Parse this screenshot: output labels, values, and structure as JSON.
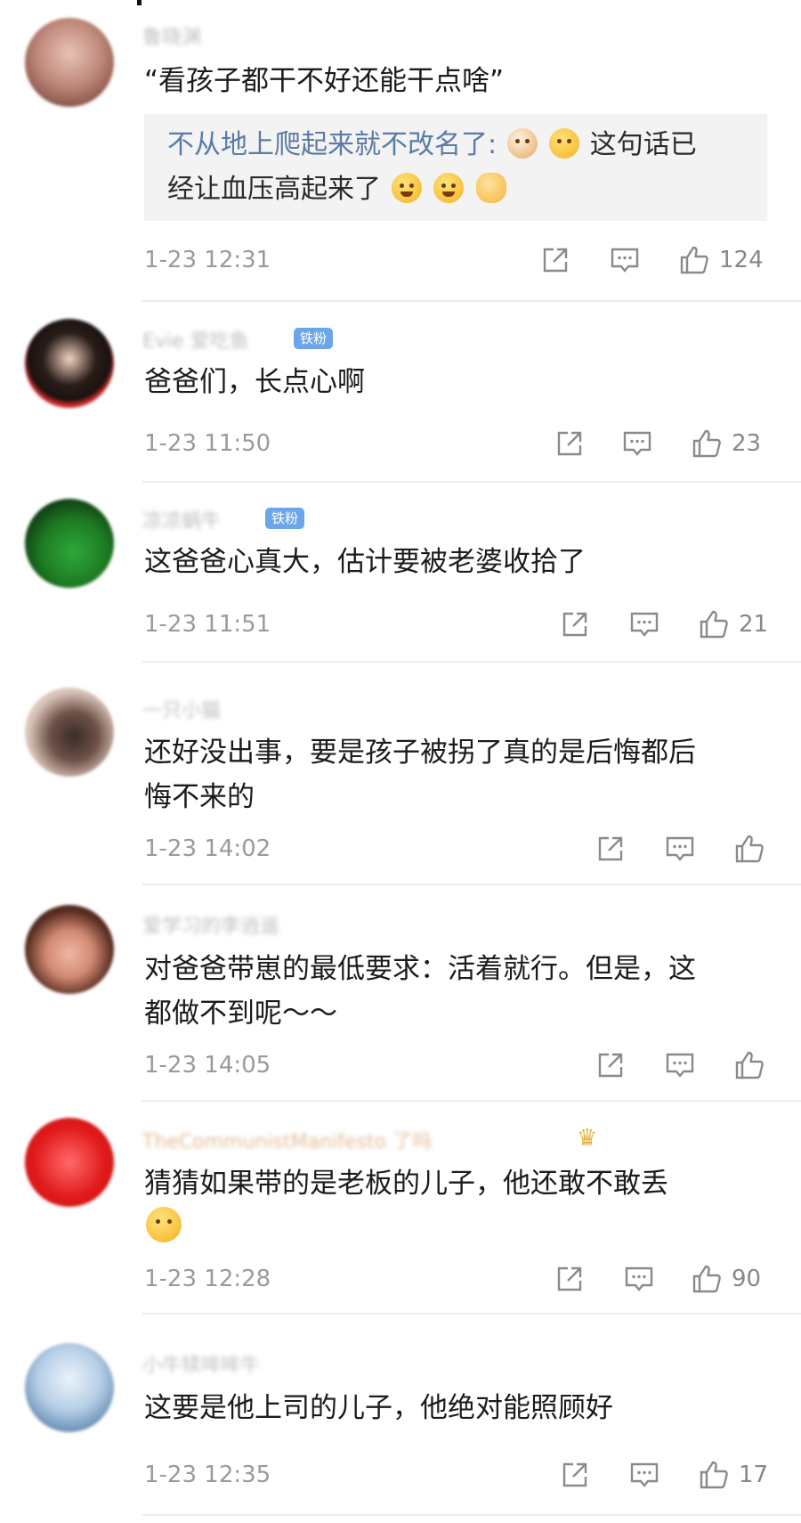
{
  "comments": [
    {
      "username": "鲁晓渊",
      "text": "“看孩子都干不好还能干点啥”",
      "reply": {
        "user": "不从地上爬起来就不改名了:",
        "text_a": "这句话已",
        "text_b": "经让血压高起来了"
      },
      "time": "1-23 12:31",
      "likes": "124"
    },
    {
      "username": "Evie 爱吃鱼",
      "badge": "铁粉",
      "text": "爸爸们，长点心啊",
      "time": "1-23 11:50",
      "likes": "23"
    },
    {
      "username": "凉凉蜗牛",
      "badge": "铁粉",
      "text": "这爸爸心真大，估计要被老婆收拾了",
      "time": "1-23 11:51",
      "likes": "21"
    },
    {
      "username": "一只小猫",
      "text_line1": "还好没出事，要是孩子被拐了真的是后悔都后",
      "text_line2": "悔不来的",
      "time": "1-23 14:02",
      "likes": ""
    },
    {
      "username": "爱学习的李逍遥",
      "text_line1": "对爸爸带崽的最低要求：活着就行。但是，这",
      "text_line2": "都做不到呢～～",
      "time": "1-23 14:05",
      "likes": ""
    },
    {
      "username": "TheCommunistManifesto 了吗",
      "text_line1": "猜猜如果带的是老板的儿子，他还敢不敢丢",
      "time": "1-23 12:28",
      "likes": "90"
    },
    {
      "username": "小牛犊哞哞牛",
      "text": "这要是他上司的儿子，他绝对能照顾好",
      "time": "1-23 12:35",
      "likes": "17"
    }
  ],
  "icons": {
    "share": "share-icon",
    "comment": "comment-icon",
    "like": "thumbs-up-icon"
  },
  "colors": {
    "reply_user": "#5a7ba5",
    "badge": "#6ba6ea",
    "meta": "#9a9a9a"
  }
}
